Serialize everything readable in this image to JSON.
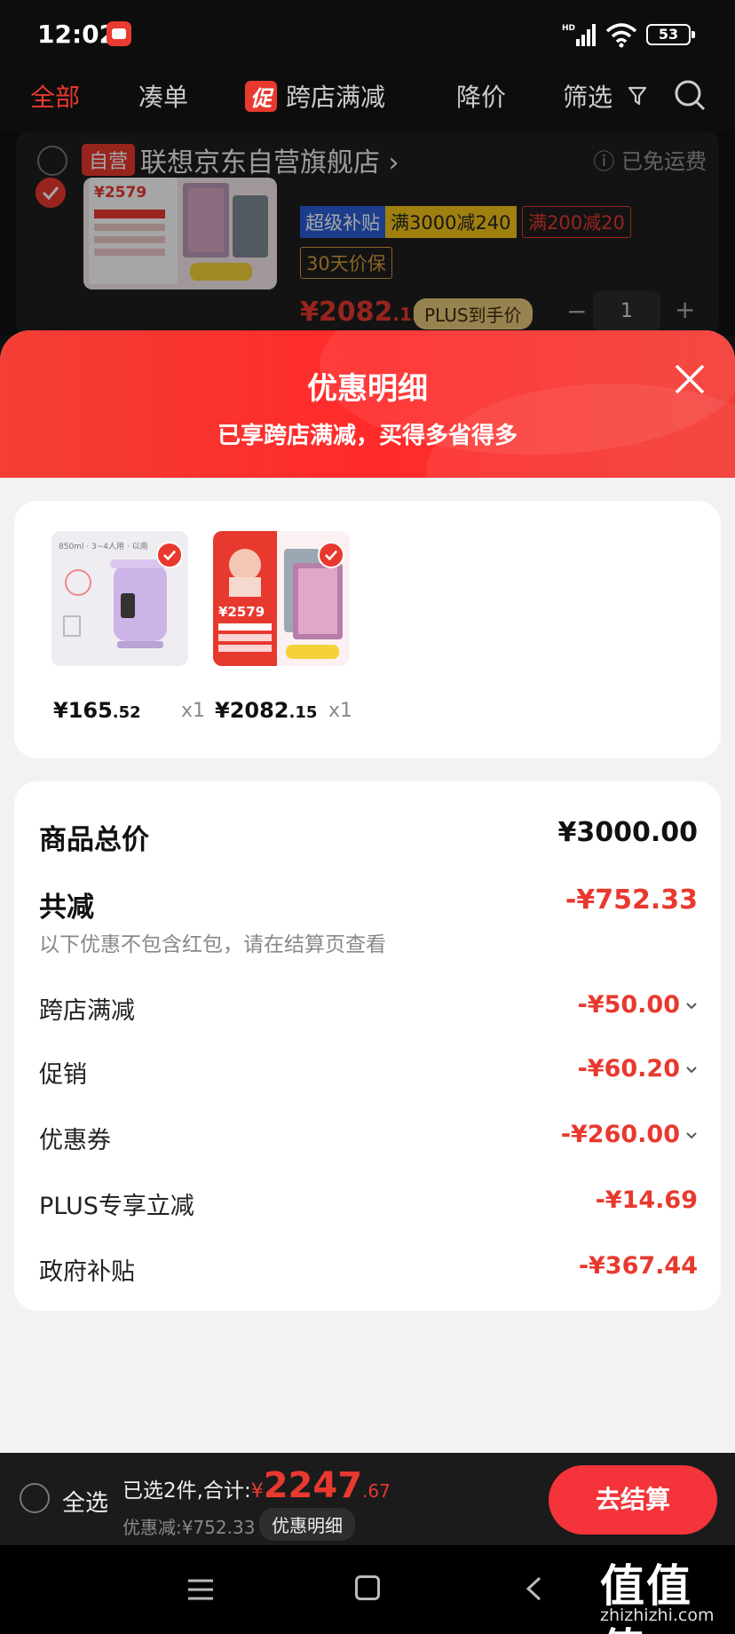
{
  "status_bar": {
    "time": "12:02",
    "battery": "53"
  },
  "nav_tabs": {
    "all": "全部",
    "bundle": "凑单",
    "promo_badge": "促",
    "cross_store": "跨店满减",
    "price_drop": "降价",
    "filter": "筛选"
  },
  "cart": {
    "shop_tag": "自营",
    "shop_name": "联想京东自营旗舰店 ›",
    "shipping": "ⓘ 已免运费",
    "thumb_price": "¥2579",
    "tag_super_a": "超级补贴",
    "tag_super_b": "满3000减240",
    "tag_discount": "满200减20",
    "tag_guarantee": "30天价保",
    "price_main": "¥2082",
    "price_dec": ".15",
    "plus_tag": "PLUS到手价",
    "qty_minus": "−",
    "qty": "1",
    "qty_plus": "+"
  },
  "sheet": {
    "title": "优惠明细",
    "subtitle": "已享跨店满减，买得多省得多"
  },
  "products": [
    {
      "price_main": "¥165",
      "price_dec": ".52",
      "qty": "x1",
      "caption": "850ml · 3~4人用 · 以南"
    },
    {
      "price_main": "¥2082",
      "price_dec": ".15",
      "qty": "x1",
      "caption": "¥2579"
    }
  ],
  "summary": {
    "total_label": "商品总价",
    "total_value": "¥3000.00",
    "reduce_label": "共减",
    "reduce_value": "-¥752.33",
    "note": "以下优惠不包含红包，请在结算页查看",
    "items": [
      {
        "label": "跨店满减",
        "value": "-¥50.00",
        "expandable": true
      },
      {
        "label": "促销",
        "value": "-¥60.20",
        "expandable": true
      },
      {
        "label": "优惠券",
        "value": "-¥260.00",
        "expandable": true
      },
      {
        "label": "PLUS专享立减",
        "value": "-¥14.69",
        "expandable": false
      },
      {
        "label": "政府补贴",
        "value": "-¥367.44",
        "expandable": false
      }
    ]
  },
  "bottom_bar": {
    "select_all": "全选",
    "selected_text": "已选2件,合计:",
    "currency": "¥",
    "total_int": "2247",
    "total_dec": ".67",
    "saved": "优惠减:¥752.33",
    "detail_button": "优惠明细",
    "checkout": "去结算"
  },
  "watermark": {
    "text": "值值值",
    "url": "zhizhizhi.com"
  },
  "colors": {
    "accent": "#e8392f",
    "header_red": "#f33f36",
    "background": "#f2f2f2"
  }
}
